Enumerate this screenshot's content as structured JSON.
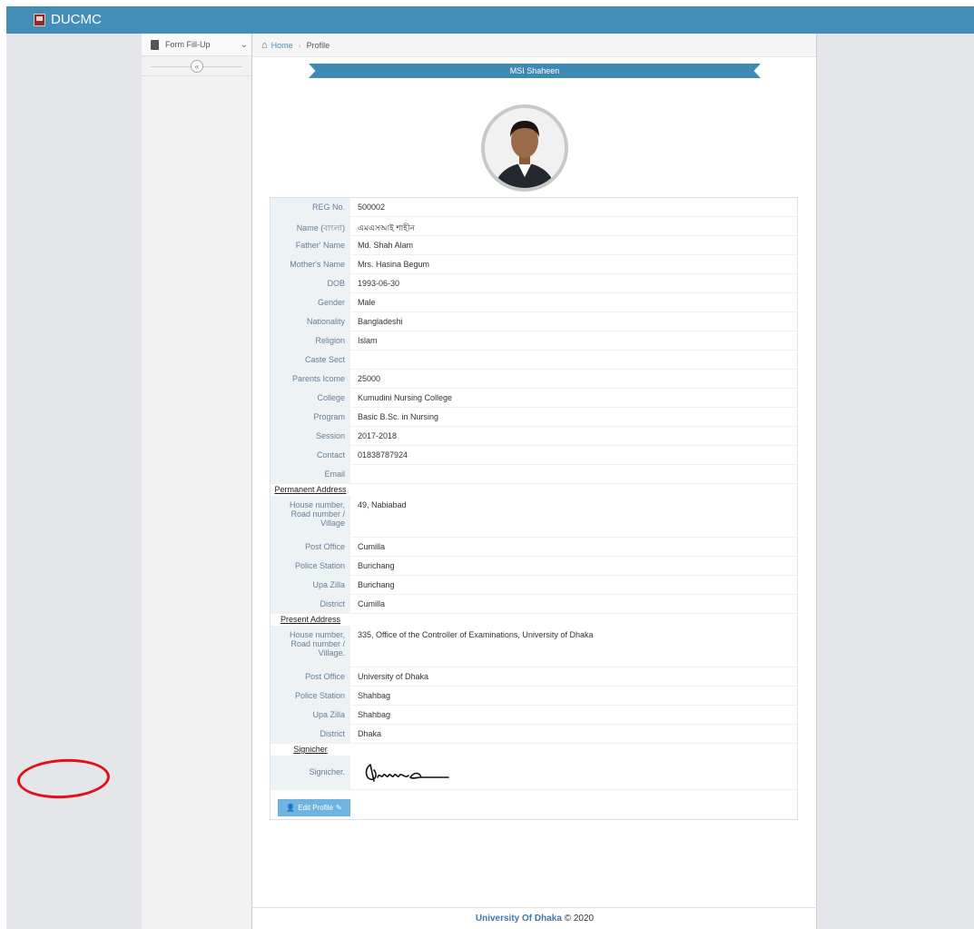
{
  "app": {
    "brand": "DUCMC"
  },
  "sidebar": {
    "menu_label": "Form Fill-Up"
  },
  "breadcrumb": {
    "home": "Home",
    "current": "Profile"
  },
  "profile": {
    "name_banner": "MSI Shaheen",
    "fields": [
      {
        "label": "REG No.",
        "value": "500002"
      },
      {
        "label": "Name (বাংলা)",
        "value": "এমএসআই শাহীন"
      },
      {
        "label": "Father' Name",
        "value": "Md. Shah Alam"
      },
      {
        "label": "Mother's Name",
        "value": "Mrs. Hasina Begum"
      },
      {
        "label": "DOB",
        "value": "1993-06-30"
      },
      {
        "label": "Gender",
        "value": "Male"
      },
      {
        "label": "Nationality",
        "value": "Bangladeshi"
      },
      {
        "label": "Religion",
        "value": "Islam"
      },
      {
        "label": "Caste Sect",
        "value": ""
      },
      {
        "label": "Parents Icome",
        "value": "25000"
      },
      {
        "label": "College",
        "value": "Kumudini Nursing College"
      },
      {
        "label": "Program",
        "value": "Basic B.Sc. in Nursing"
      },
      {
        "label": "Session",
        "value": "2017-2018"
      },
      {
        "label": "Contact",
        "value": "01838787924"
      },
      {
        "label": "Email",
        "value": ""
      }
    ],
    "permanent": {
      "heading": "Permanent Address",
      "fields": [
        {
          "label": "House number, Road number / Village",
          "value": "49, Nabiabad"
        },
        {
          "label": "Post Office",
          "value": "Cumilla"
        },
        {
          "label": "Police Station",
          "value": "Burichang"
        },
        {
          "label": "Upa Zilla",
          "value": "Burichang"
        },
        {
          "label": "District",
          "value": "Cumilla"
        }
      ]
    },
    "present": {
      "heading": "Present Address",
      "fields": [
        {
          "label": "House number, Road number / Village.",
          "value": "335, Office of the Controller of Examinations, University of Dhaka"
        },
        {
          "label": "Post Office",
          "value": "University of Dhaka"
        },
        {
          "label": "Police Station",
          "value": "Shahbag"
        },
        {
          "label": "Upa Zilla",
          "value": "Shahbag"
        },
        {
          "label": "District",
          "value": "Dhaka"
        }
      ]
    },
    "signature": {
      "heading": "Signicher",
      "label": "Signicher."
    },
    "edit_button": "Edit Profile"
  },
  "footer": {
    "university": "University Of Dhaka",
    "copyright": "© 2020"
  },
  "colors": {
    "topbar": "#438eb9",
    "ribbon": "#3f8ab5",
    "button": "#6fb3e0",
    "highlight": "#e3101a"
  }
}
